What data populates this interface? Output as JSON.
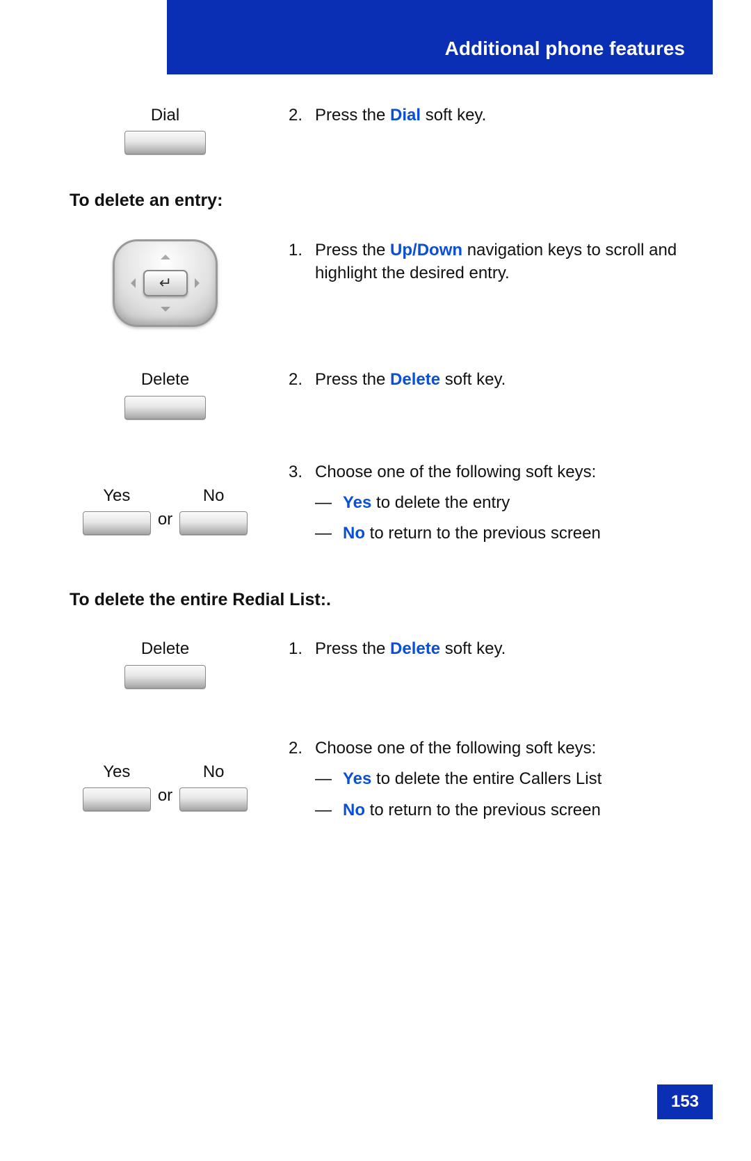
{
  "header_title": "Additional phone features",
  "sectionA": {
    "dial": {
      "label": "Dial",
      "num": "2.",
      "text_before": "Press the ",
      "kw": "Dial",
      "text_after": " soft key."
    }
  },
  "delete_entry": {
    "heading": "To delete an entry:",
    "step1": {
      "num": "1.",
      "pre": "Press the ",
      "kw": "Up/Down",
      "post": " navigation keys to scroll and highlight the desired entry."
    },
    "step2": {
      "label": "Delete",
      "num": "2.",
      "pre": "Press the ",
      "kw": "Delete",
      "post": " soft key."
    },
    "step3": {
      "num": "3.",
      "intro": "Choose one of the following soft keys:",
      "yes_label": "Yes",
      "no_label": "No",
      "or": "or",
      "bullet1_kw": "Yes",
      "bullet1_rest": " to delete the entry",
      "bullet2_kw": "No",
      "bullet2_rest": " to return to the previous screen"
    }
  },
  "delete_all": {
    "heading": "To delete the entire Redial List:.",
    "step1": {
      "label": "Delete",
      "num": "1.",
      "pre": "Press the ",
      "kw": "Delete",
      "post": " soft key."
    },
    "step2": {
      "num": "2.",
      "intro": "Choose one of the following soft keys:",
      "yes_label": "Yes",
      "no_label": "No",
      "or": "or",
      "bullet1_kw": "Yes",
      "bullet1_rest": " to delete the entire Callers List",
      "bullet2_kw": "No",
      "bullet2_rest": " to return to the previous screen"
    }
  },
  "page_number": "153"
}
